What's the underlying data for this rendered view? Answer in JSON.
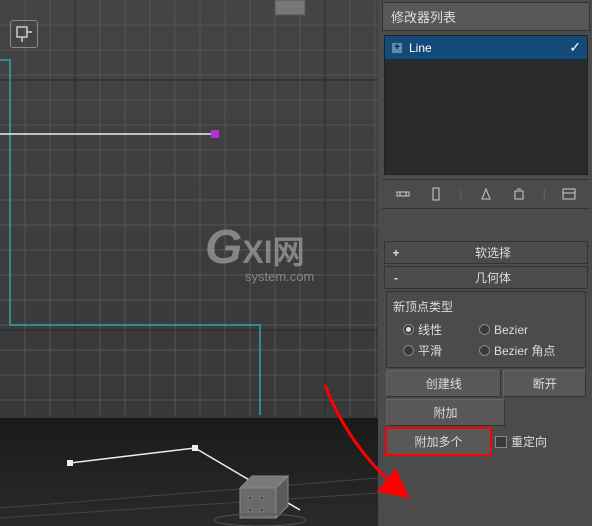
{
  "modifier_list_label": "修改器列表",
  "stack": {
    "item0": {
      "label": "Line"
    }
  },
  "rollouts": {
    "soft_selection": {
      "title": "软选择"
    },
    "geometry": {
      "title": "几何体"
    }
  },
  "new_vertex_type": {
    "group_label": "新顶点类型",
    "linear": "线性",
    "smooth": "平滑",
    "bezier": "Bezier",
    "bezier_corner": "Bezier 角点"
  },
  "buttons": {
    "create_line": "创建线",
    "break": "断开",
    "attach": "附加",
    "attach_multi": "附加多个",
    "reorient": "重定向"
  },
  "watermark": {
    "big_g": "G",
    "rest": "XI",
    "cn": "网",
    "sub": "system.com"
  }
}
